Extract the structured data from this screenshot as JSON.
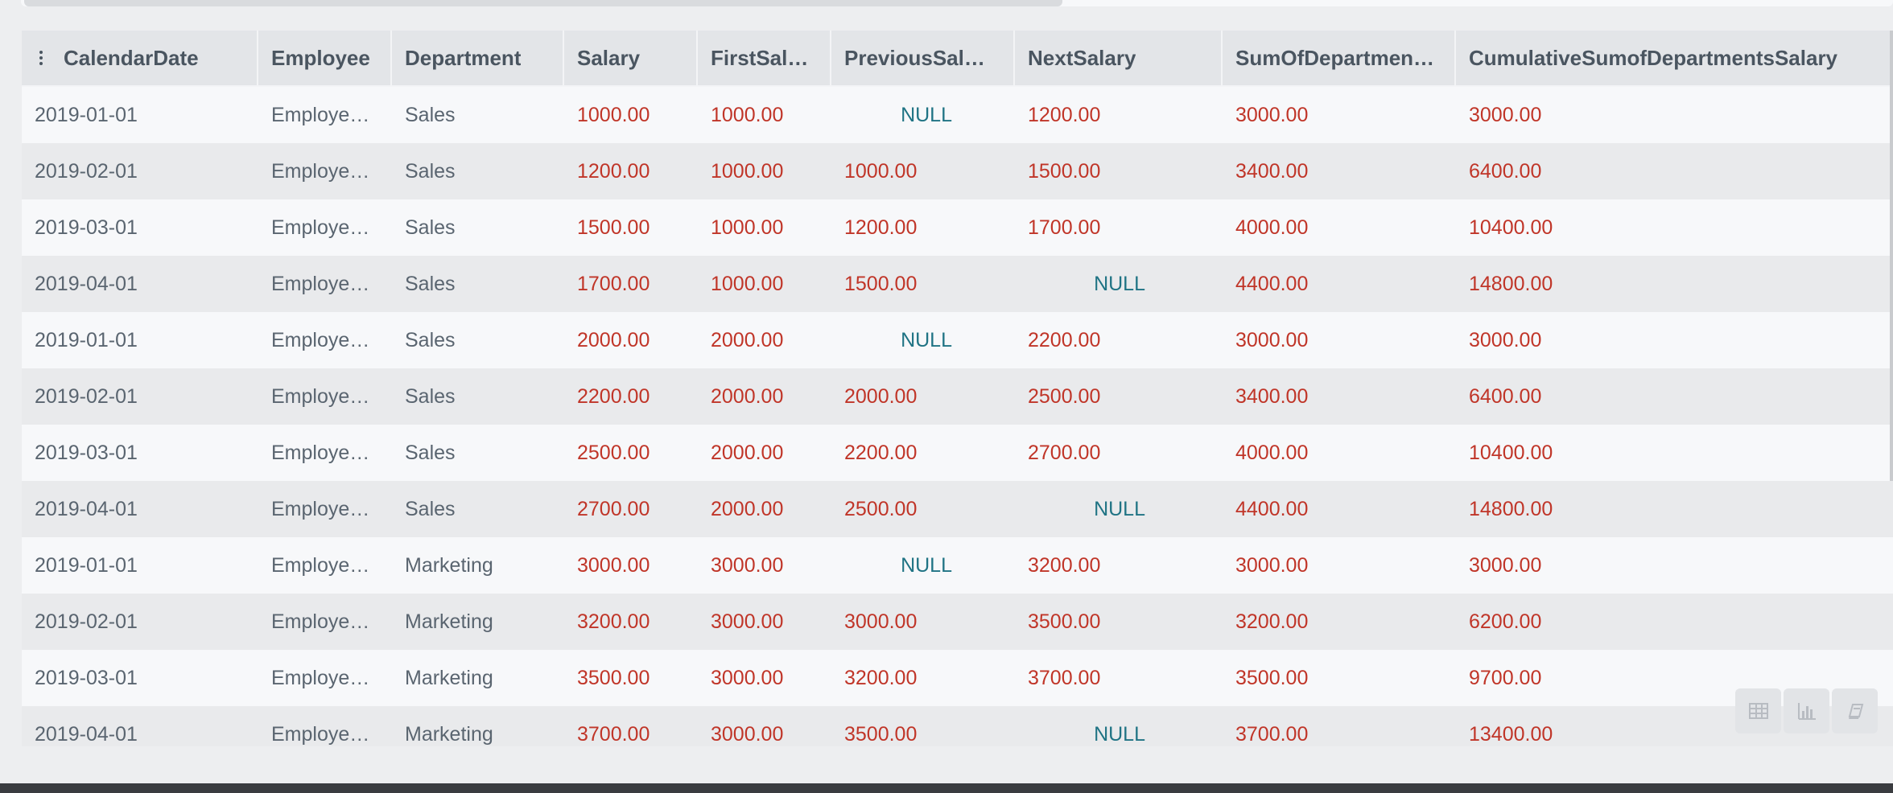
{
  "grid": {
    "columns": [
      {
        "label": "CalendarDate",
        "type": "text"
      },
      {
        "label": "Employee",
        "type": "text"
      },
      {
        "label": "Department",
        "type": "text"
      },
      {
        "label": "Salary",
        "type": "num"
      },
      {
        "label": "FirstSal…",
        "type": "num"
      },
      {
        "label": "PreviousSal…",
        "type": "num"
      },
      {
        "label": "NextSalary",
        "type": "num"
      },
      {
        "label": "SumOfDepartmen…",
        "type": "num"
      },
      {
        "label": "CumulativeSumofDepartmentsSalary",
        "type": "num"
      }
    ],
    "rows": [
      [
        "2019-01-01",
        "Employe…",
        "Sales",
        "1000.00",
        "1000.00",
        "NULL",
        "1200.00",
        "3000.00",
        "3000.00"
      ],
      [
        "2019-02-01",
        "Employe…",
        "Sales",
        "1200.00",
        "1000.00",
        "1000.00",
        "1500.00",
        "3400.00",
        "6400.00"
      ],
      [
        "2019-03-01",
        "Employe…",
        "Sales",
        "1500.00",
        "1000.00",
        "1200.00",
        "1700.00",
        "4000.00",
        "10400.00"
      ],
      [
        "2019-04-01",
        "Employe…",
        "Sales",
        "1700.00",
        "1000.00",
        "1500.00",
        "NULL",
        "4400.00",
        "14800.00"
      ],
      [
        "2019-01-01",
        "Employe…",
        "Sales",
        "2000.00",
        "2000.00",
        "NULL",
        "2200.00",
        "3000.00",
        "3000.00"
      ],
      [
        "2019-02-01",
        "Employe…",
        "Sales",
        "2200.00",
        "2000.00",
        "2000.00",
        "2500.00",
        "3400.00",
        "6400.00"
      ],
      [
        "2019-03-01",
        "Employe…",
        "Sales",
        "2500.00",
        "2000.00",
        "2200.00",
        "2700.00",
        "4000.00",
        "10400.00"
      ],
      [
        "2019-04-01",
        "Employe…",
        "Sales",
        "2700.00",
        "2000.00",
        "2500.00",
        "NULL",
        "4400.00",
        "14800.00"
      ],
      [
        "2019-01-01",
        "Employe…",
        "Marketing",
        "3000.00",
        "3000.00",
        "NULL",
        "3200.00",
        "3000.00",
        "3000.00"
      ],
      [
        "2019-02-01",
        "Employe…",
        "Marketing",
        "3200.00",
        "3000.00",
        "3000.00",
        "3500.00",
        "3200.00",
        "6200.00"
      ],
      [
        "2019-03-01",
        "Employe…",
        "Marketing",
        "3500.00",
        "3000.00",
        "3200.00",
        "3700.00",
        "3500.00",
        "9700.00"
      ],
      [
        "2019-04-01",
        "Employe…",
        "Marketing",
        "3700.00",
        "3000.00",
        "3500.00",
        "NULL",
        "3700.00",
        "13400.00"
      ]
    ]
  },
  "toolbar": {
    "modes": [
      {
        "icon": "table-icon",
        "name": "table-view-button"
      },
      {
        "icon": "chart-icon",
        "name": "chart-view-button"
      },
      {
        "icon": "book-icon",
        "name": "notes-view-button"
      }
    ]
  },
  "colors": {
    "number": "#c03528",
    "null": "#1f7384",
    "text": "#5a6570",
    "header_text": "#4a5560"
  }
}
